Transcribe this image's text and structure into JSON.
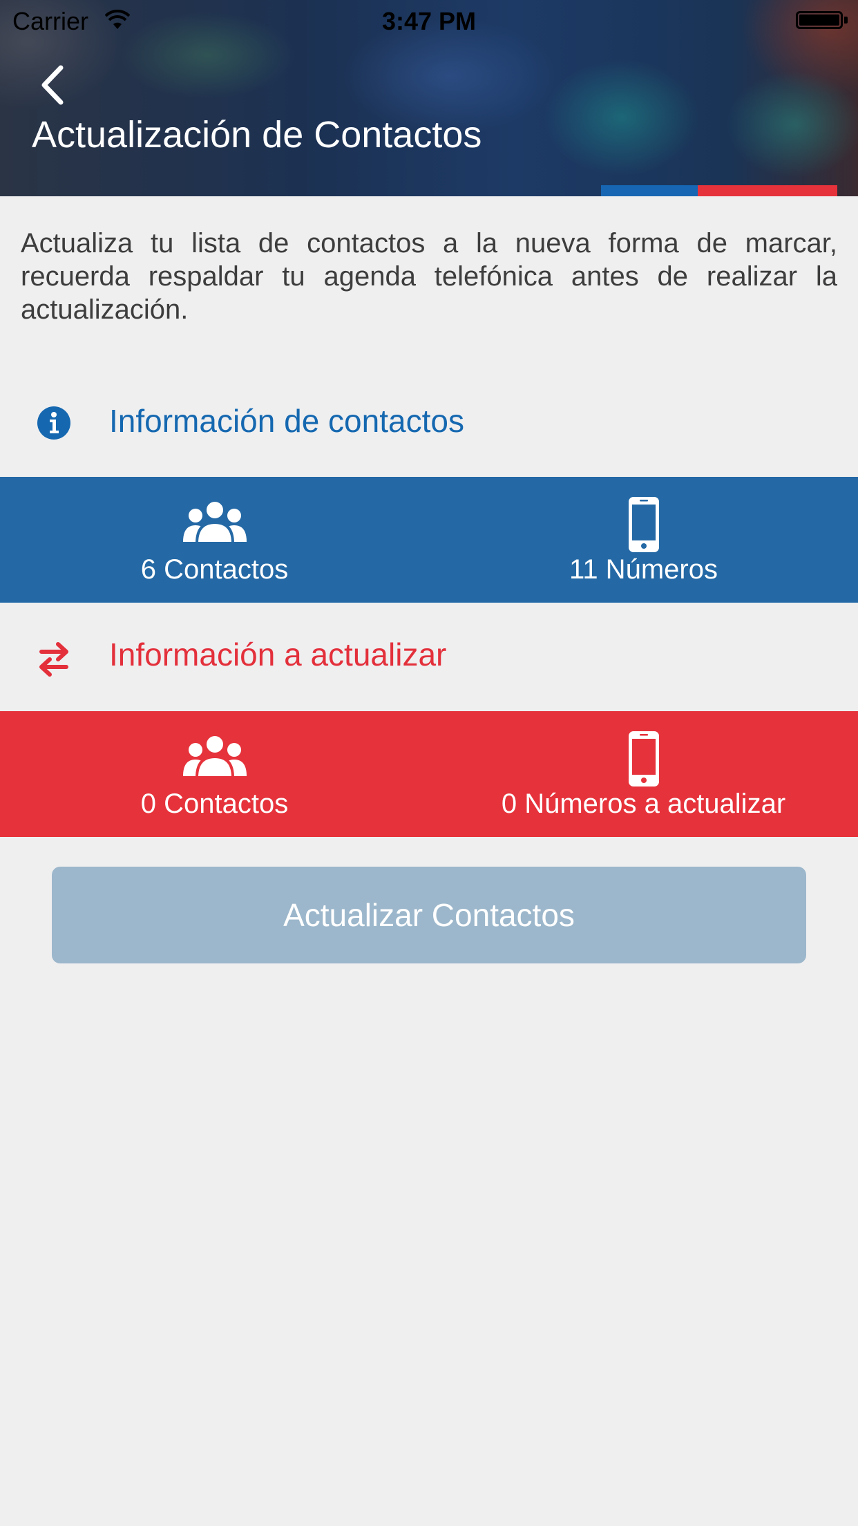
{
  "status_bar": {
    "carrier": "Carrier",
    "time": "3:47 PM"
  },
  "header": {
    "title": "Actualización de Contactos",
    "back_icon": "chevron-left-icon"
  },
  "description": "Actualiza tu lista de contactos a la nueva forma de marcar, recuerda respaldar tu agenda telefónica antes de realizar la actualización.",
  "sections": {
    "info": {
      "label": "Información de contactos",
      "icon": "info-icon",
      "color": "#1568b0",
      "band_color": "#2469a5",
      "contacts_label": "6 Contactos",
      "numbers_label": "11 Números"
    },
    "update": {
      "label": "Información a actualizar",
      "icon": "swap-arrows-icon",
      "color": "#e3303b",
      "band_color": "#e6323b",
      "contacts_label": "0 Contactos",
      "numbers_label": "0 Números a actualizar"
    }
  },
  "button": {
    "label": "Actualizar Contactos",
    "color": "#9cb7cb"
  }
}
